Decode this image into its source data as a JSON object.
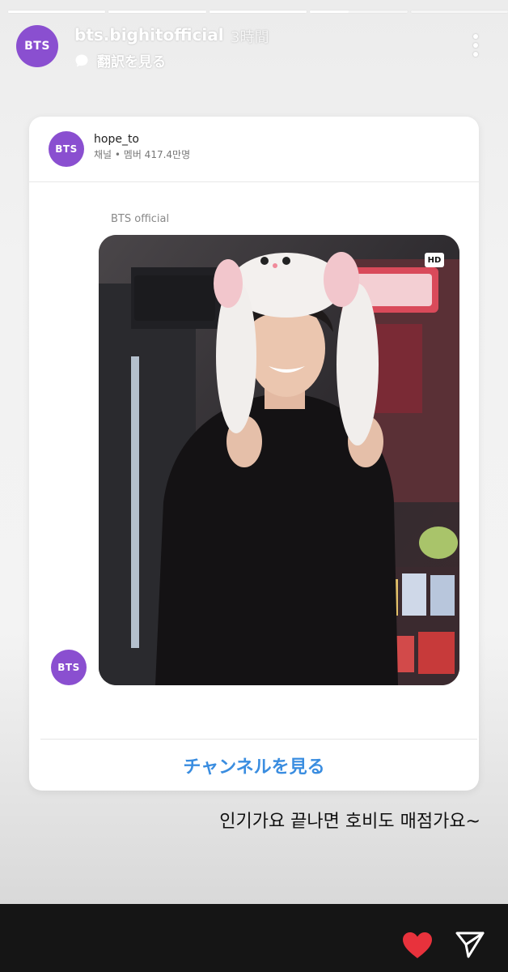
{
  "story": {
    "progress_segments": [
      1,
      1,
      1,
      0.4,
      0
    ],
    "account": {
      "avatar_text": "BTS",
      "username": "bts.bighitofficial",
      "time": "3時間",
      "translate_label": "翻訳を見る"
    },
    "card": {
      "channel": {
        "avatar_text": "BTS",
        "name": "hope_to",
        "meta": "채널 • 멤버 417.4만명"
      },
      "message": {
        "sender": "BTS official",
        "hd_badge": "HD",
        "avatar_text": "BTS"
      },
      "button_label": "チャンネルを見る"
    },
    "caption": "인기가요 끝나면 호비도 매점가요~"
  },
  "colors": {
    "avatar": "#8a4fd0",
    "link_blue": "#3a8de0",
    "heart_red": "#e8323c"
  }
}
